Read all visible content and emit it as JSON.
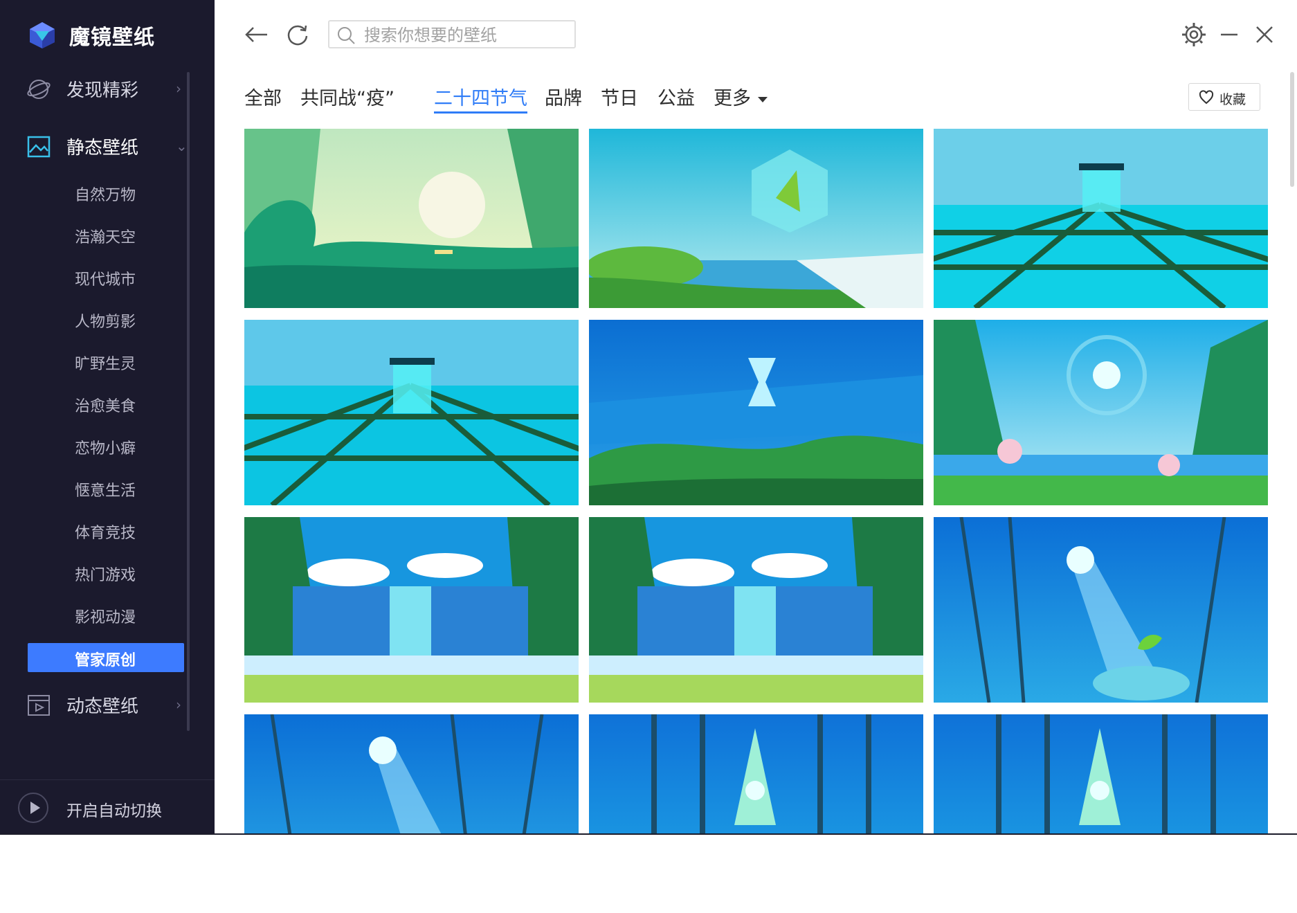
{
  "app": {
    "name": "魔镜壁纸"
  },
  "sidebar": {
    "nav": [
      {
        "label": "发现精彩",
        "icon": "planet-icon"
      },
      {
        "label": "静态壁纸",
        "icon": "image-frame-icon"
      },
      {
        "label": "动态壁纸",
        "icon": "video-frame-icon"
      }
    ],
    "subitems": [
      "自然万物",
      "浩瀚天空",
      "现代城市",
      "人物剪影",
      "旷野生灵",
      "治愈美食",
      "恋物小癖",
      "惬意生活",
      "体育竞技",
      "热门游戏",
      "影视动漫"
    ],
    "active_subitem": "管家原创",
    "auto_switch_label": "开启自动切换"
  },
  "search": {
    "placeholder": "搜索你想要的壁纸"
  },
  "categories": {
    "tabs": [
      "全部",
      "共同战“疫”",
      "二十四节气",
      "品牌",
      "节日",
      "公益",
      "更多"
    ],
    "active": "二十四节气"
  },
  "favorite_label": "收藏",
  "thumbnails": [
    {
      "scene": "wave-surfer"
    },
    {
      "scene": "crystal-cube-lake"
    },
    {
      "scene": "grid-field-cube"
    },
    {
      "scene": "grid-field-cube"
    },
    {
      "scene": "hourglass-lake"
    },
    {
      "scene": "windmill-bay"
    },
    {
      "scene": "waterfall-valley"
    },
    {
      "scene": "waterfall-valley"
    },
    {
      "scene": "forest-sprout"
    },
    {
      "scene": "forest-beam"
    },
    {
      "scene": "bamboo-tree"
    },
    {
      "scene": "bamboo-tree"
    }
  ],
  "colors": {
    "sidebar_bg": "#1b1a2d",
    "accent": "#2f7cf7",
    "active_item": "#3d7bff"
  }
}
